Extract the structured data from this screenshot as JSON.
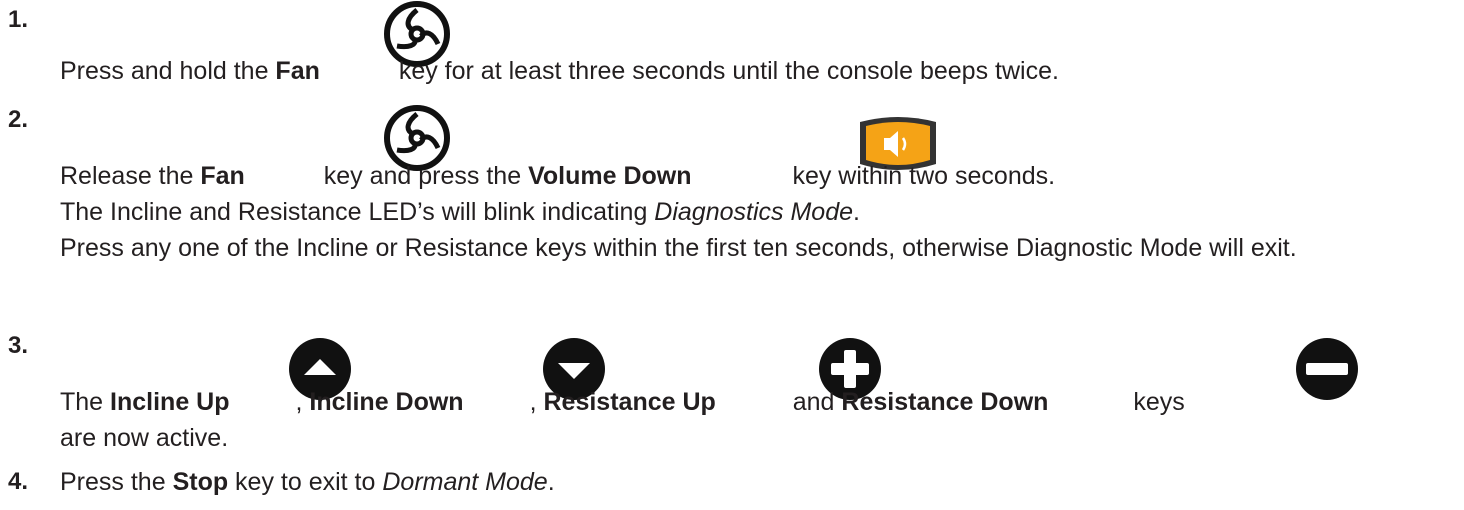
{
  "steps": [
    {
      "number": "1.",
      "text": {
        "a": "Press and hold the ",
        "b_key": "Fan",
        "c": " key for at least three seconds until the console beeps twice."
      }
    },
    {
      "number": "2.",
      "line1": {
        "a": "Release the ",
        "b_key": "Fan",
        "c": " key and press the ",
        "d_key": "Volume Down",
        "e": " key within two seconds."
      },
      "line2": {
        "a": "The Incline and Resistance LED’s will blink indicating ",
        "b_em": "Diagnostics Mode",
        "c": "."
      },
      "line3": "Press any one of the Incline or Resistance keys within the first ten seconds, otherwise Diagnostic Mode will exit."
    },
    {
      "number": "3.",
      "line1": {
        "a": "The ",
        "b_key": "Incline Up",
        "c": ", ",
        "d_key": "Incline Down",
        "e": ", ",
        "f_key": "Resistance Up",
        "g": " and ",
        "h_key": "Resistance Down",
        "i": " keys"
      },
      "line2": "are now active."
    },
    {
      "number": "4.",
      "text": {
        "a": "Press the ",
        "b_key": "Stop",
        "c": " key to exit to ",
        "d_em": "Dormant Mode",
        "e": "."
      }
    }
  ],
  "icons": [
    "fan-icon",
    "volume-down-icon",
    "incline-up-icon",
    "incline-down-icon",
    "resistance-up-icon",
    "resistance-down-icon"
  ],
  "colors": {
    "text": "#231f20",
    "icon_dark": "#111111",
    "volume_orange": "#f5a316"
  }
}
